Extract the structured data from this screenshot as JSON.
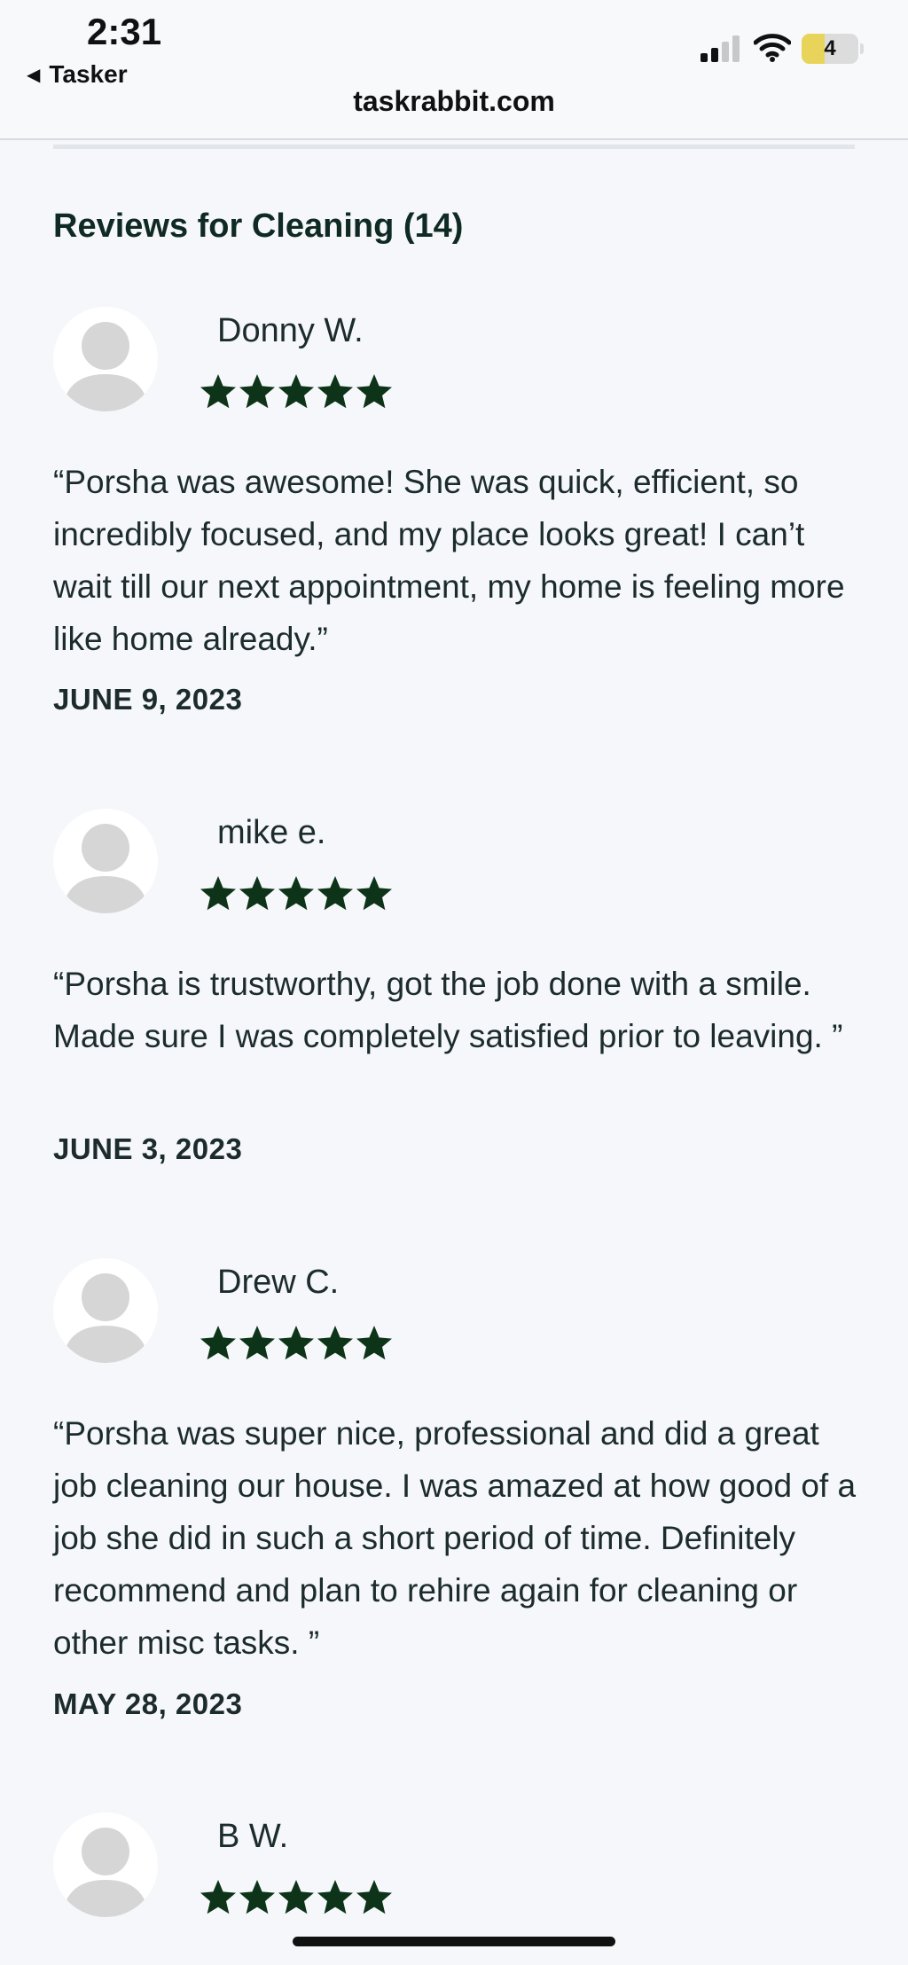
{
  "status_bar": {
    "time": "2:31",
    "back_label": "Tasker",
    "back_icon": "back-triangle",
    "url": "taskrabbit.com",
    "battery_percent": 40,
    "battery_label": "4",
    "signal_bars_active": 2,
    "signal_bars_total": 4
  },
  "reviews_section": {
    "title": "Reviews for Cleaning (14)",
    "reviews": [
      {
        "name": "Donny W.",
        "rating": 5,
        "text": "“Porsha was awesome! She was quick, efficient, so incredibly focused, and my place looks great! I can’t wait till our next appointment, my home is feeling more like home already.”",
        "date": "JUNE 9, 2023"
      },
      {
        "name": "mike e.",
        "rating": 5,
        "text": "“Porsha is trustworthy, got the job done with a smile. Made sure I was completely satisfied prior to leaving. ”",
        "date": "JUNE 3, 2023"
      },
      {
        "name": "Drew C.",
        "rating": 5,
        "text": "“Porsha was super nice, professional and did a great job cleaning our house. I was amazed at how good of a job she did in such a short period of time. Definitely recommend and plan to rehire again for cleaning or other misc tasks. ”",
        "date": "MAY 28, 2023"
      },
      {
        "name": "B W.",
        "rating": 5,
        "text": "",
        "date": ""
      }
    ]
  },
  "colors": {
    "background": "#f5f7fa",
    "star": "#0d3318",
    "title": "#0f2a22",
    "text": "#1c2b2c",
    "avatar_silhouette": "#d6d6d6"
  }
}
